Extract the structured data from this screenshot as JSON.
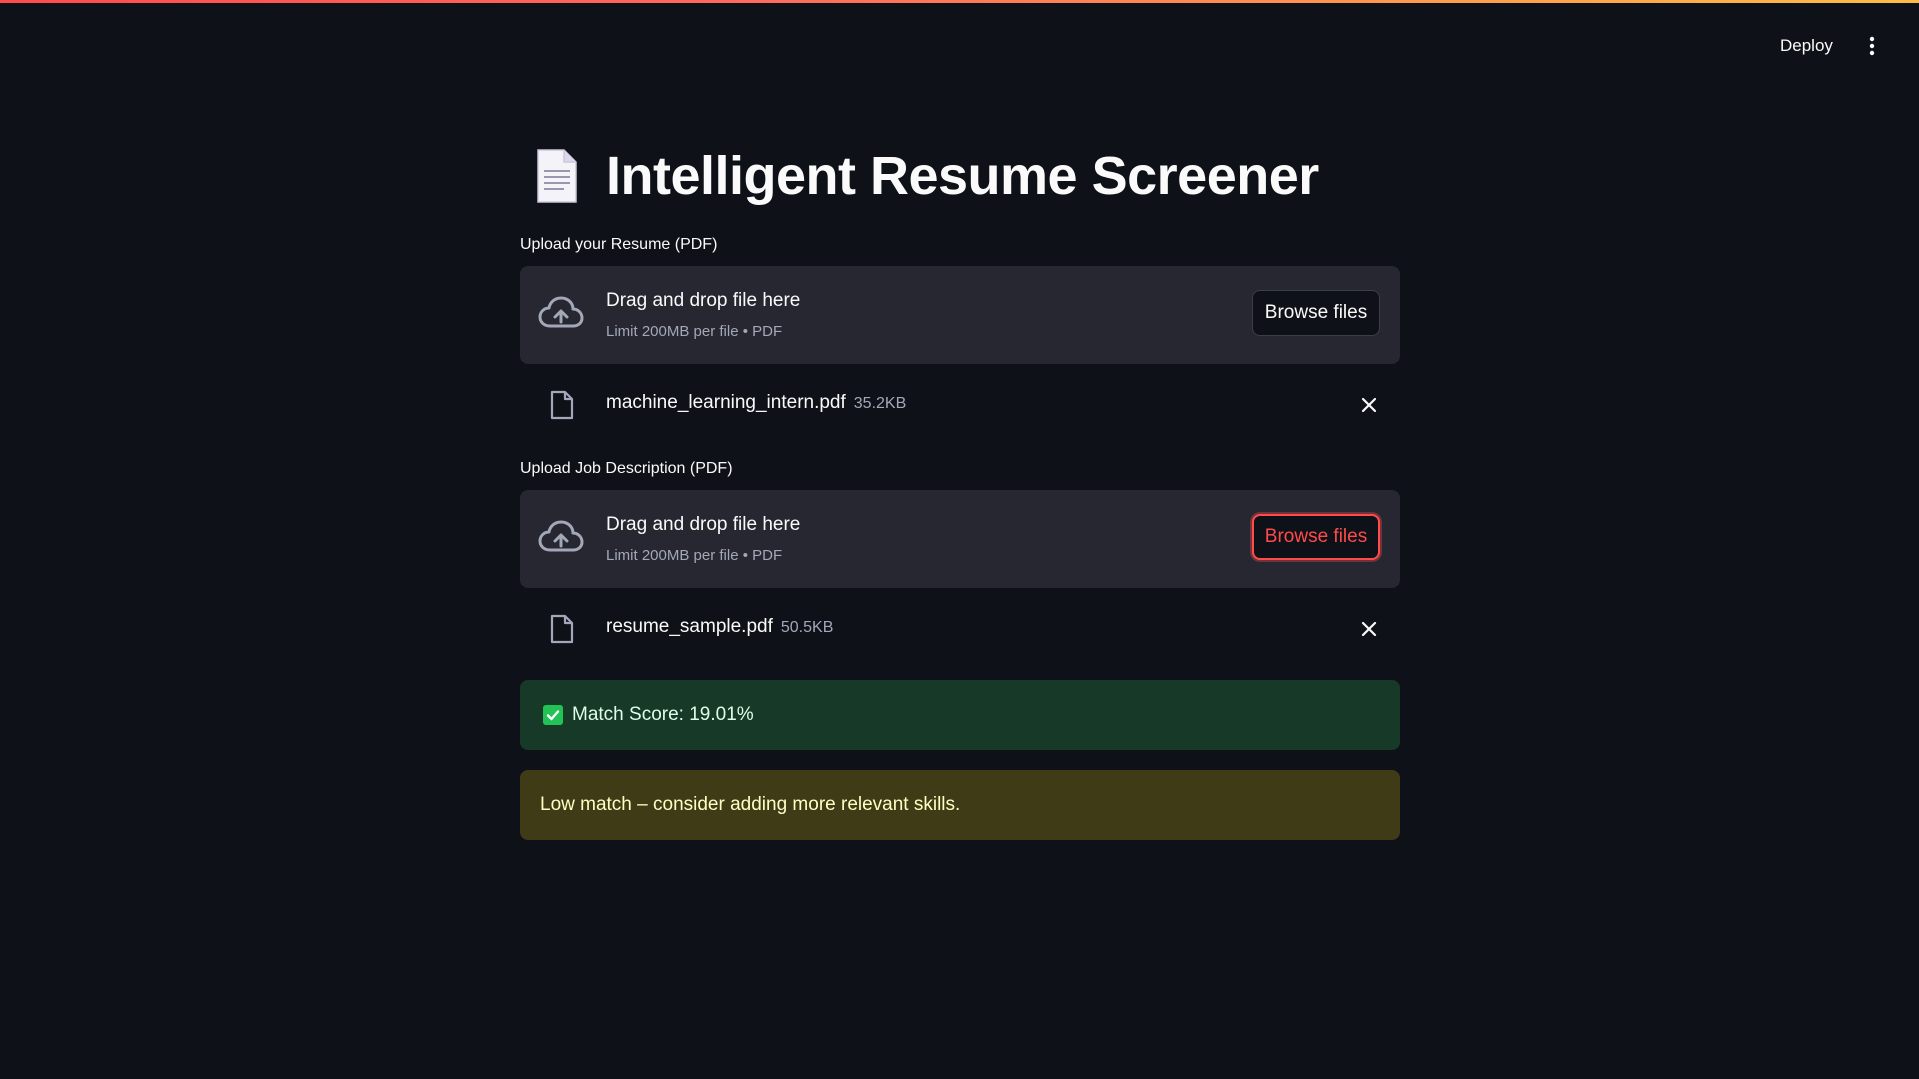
{
  "header": {
    "deploy_label": "Deploy",
    "menu_icon": "kebab-menu-icon"
  },
  "page": {
    "title_icon": "page-facing-up-icon",
    "title": "Intelligent Resume Screener"
  },
  "resume_uploader": {
    "label": "Upload your Resume (PDF)",
    "dropzone_title": "Drag and drop file here",
    "dropzone_sub": "Limit 200MB per file • PDF",
    "browse_label": "Browse files",
    "file": {
      "name": "machine_learning_intern.pdf",
      "size": "35.2KB"
    }
  },
  "jd_uploader": {
    "label": "Upload Job Description (PDF)",
    "dropzone_title": "Drag and drop file here",
    "dropzone_sub": "Limit 200MB per file • PDF",
    "browse_label": "Browse files",
    "file": {
      "name": "resume_sample.pdf",
      "size": "50.5KB"
    }
  },
  "result": {
    "success_text": "Match Score: 19.01%",
    "warning_text": "Low match – consider adding more relevant skills."
  },
  "colors": {
    "background": "#0e1117",
    "accent": "#ff4b4b",
    "success_bg": "#173928",
    "warning_bg": "#3e3b16"
  }
}
